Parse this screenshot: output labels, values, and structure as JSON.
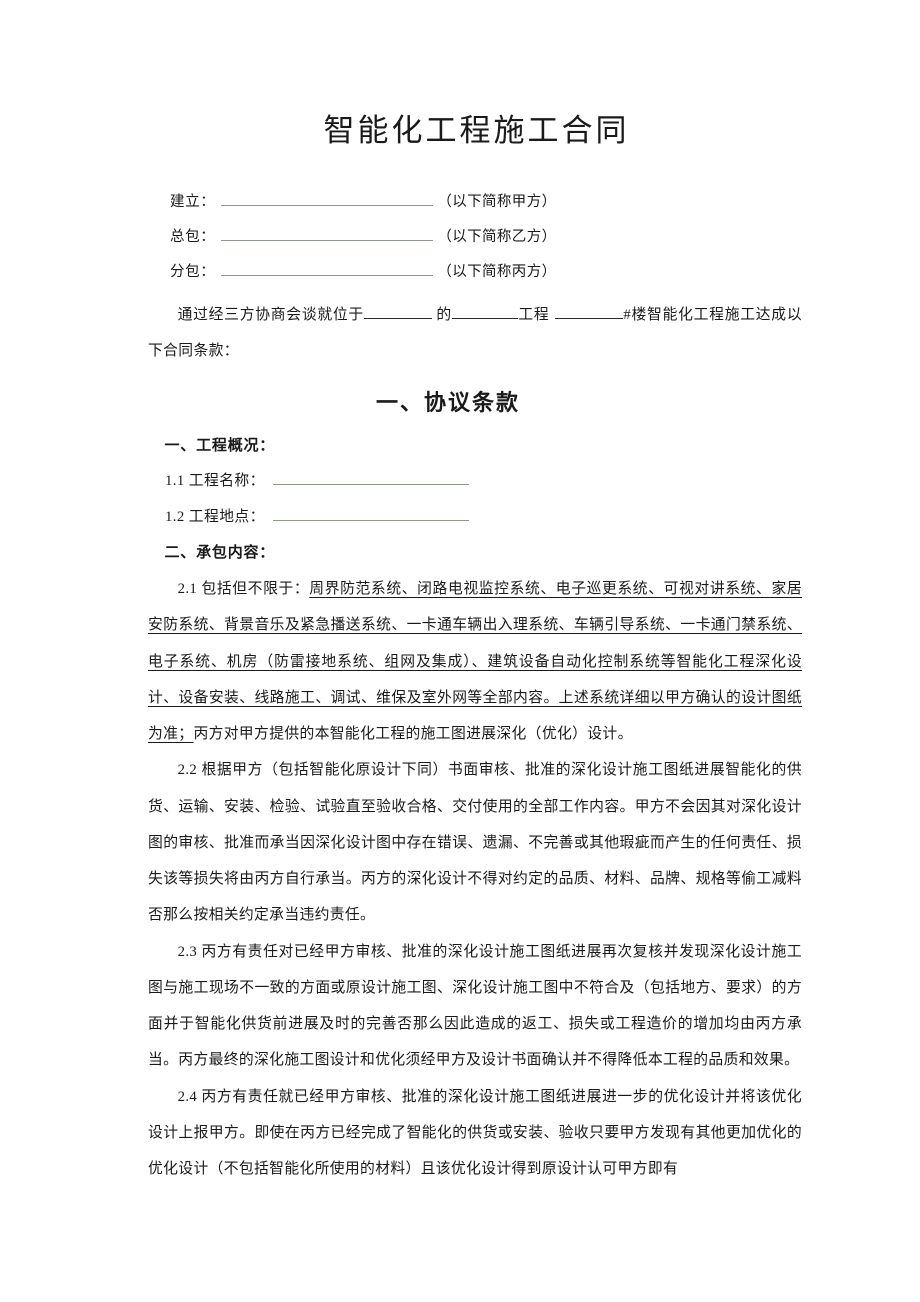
{
  "document": {
    "title": "智能化工程施工合同"
  },
  "parties": {
    "rows": [
      {
        "label": "建立：",
        "note": "（以下简称甲方）"
      },
      {
        "label": "总包：",
        "note": "（以下简称乙方）"
      },
      {
        "label": "分包：",
        "note": "（以下简称丙方）"
      }
    ]
  },
  "intro": {
    "lead": "通过经三方协商会谈就位于",
    "mid1": "的",
    "mid2": "工程",
    "tail": "#楼智能化工程施工达成以下合同条款："
  },
  "section": {
    "heading": "一、协议条款"
  },
  "overview": {
    "heading": "一、工程概况：",
    "fields": [
      {
        "label": "1.1 工程名称："
      },
      {
        "label": "1.2 工程地点："
      }
    ]
  },
  "scope": {
    "heading": "二、承包内容：",
    "clauses": [
      {
        "id": "2.1",
        "prefix": "2.1 包括但不限于：",
        "underlined": "周界防范系统、闭路电视监控系统、电子巡更系统、可视对讲系统、家居安防系统、背景音乐及紧急播送系统、一卡通车辆出入理系统、车辆引导系统、一卡通门禁系统、电子系统、机房（防雷接地系统、组网及集成）、建筑设备自动化控制系统等智能化工程深化设计、设备安装、线路施工、调试、维保及室外网等全部内容。上述系统详细以甲方确认的设计图纸为准；",
        "suffix": "丙方对甲方提供的本智能化工程的施工图进展深化（优化）设计。"
      },
      {
        "id": "2.2",
        "text": "2.2 根据甲方（包括智能化原设计下同）书面审核、批准的深化设计施工图纸进展智能化的供货、运输、安装、检验、试验直至验收合格、交付使用的全部工作内容。甲方不会因其对深化设计图的审核、批准而承当因深化设计图中存在错误、遗漏、不完善或其他瑕疵而产生的任何责任、损失该等损失将由丙方自行承当。丙方的深化设计不得对约定的品质、材料、品牌、规格等偷工减料否那么按相关约定承当违约责任。"
      },
      {
        "id": "2.3",
        "text": "2.3 丙方有责任对已经甲方审核、批准的深化设计施工图纸进展再次复核并发现深化设计施工图与施工现场不一致的方面或原设计施工图、深化设计施工图中不符合及（包括地方、要求）的方面并于智能化供货前进展及时的完善否那么因此造成的返工、损失或工程造价的增加均由丙方承当。丙方最终的深化施工图设计和优化须经甲方及设计书面确认并不得降低本工程的品质和效果。"
      },
      {
        "id": "2.4",
        "text": "2.4 丙方有责任就已经甲方审核、批准的深化设计施工图纸进展进一步的优化设计并将该优化设计上报甲方。即使在丙方已经完成了智能化的供货或安装、验收只要甲方发现有其他更加优化的优化设计（不包括智能化所使用的材料）且该优化设计得到原设计认可甲方即有"
      }
    ]
  },
  "colors": {
    "text": "#1a1a1a",
    "field_underline": "#8c9a8c",
    "inline_underline": "#2b2b2b"
  }
}
